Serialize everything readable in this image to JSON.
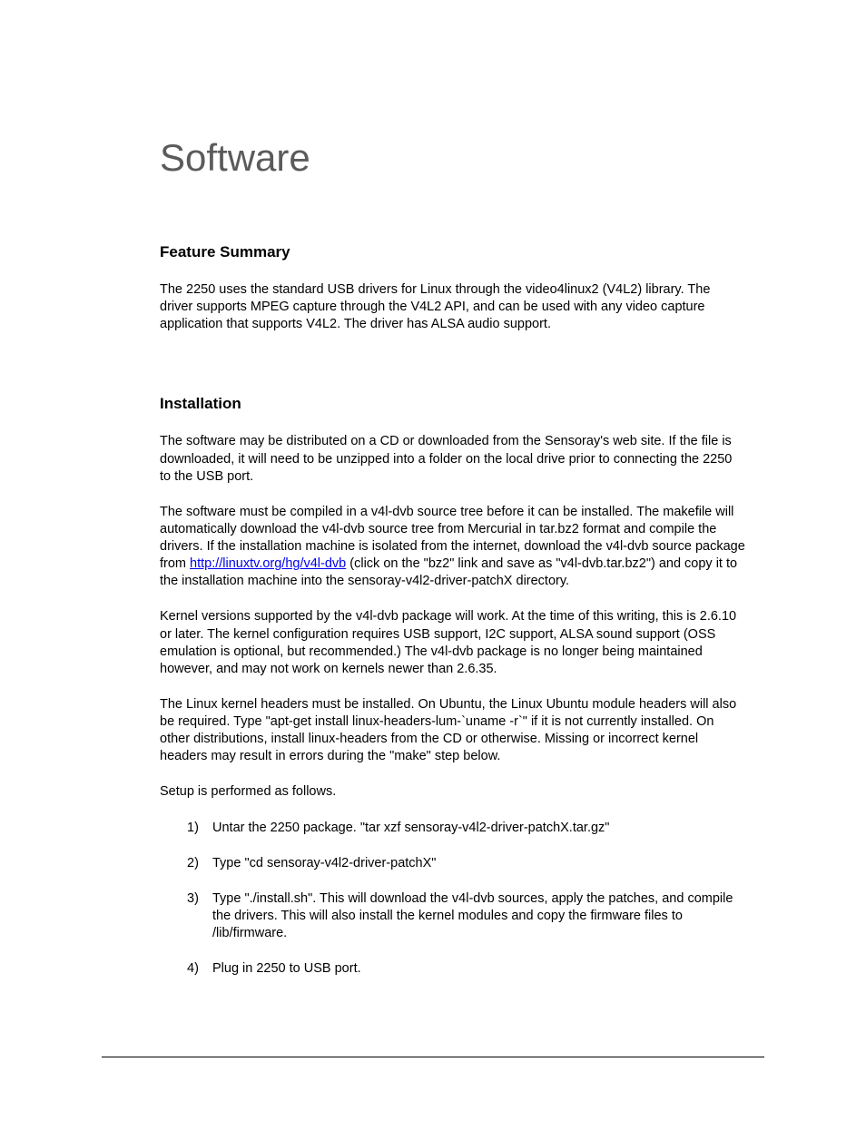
{
  "title": "Software",
  "sections": {
    "feature": {
      "heading": "Feature Summary",
      "p1": "The 2250 uses the standard USB drivers for Linux through the video4linux2 (V4L2) library.  The driver supports MPEG capture through the V4L2 API, and can be used with any video capture application that supports V4L2.  The driver has ALSA audio support."
    },
    "install": {
      "heading": "Installation",
      "p1": "The software may be distributed on a CD or downloaded from the Sensoray's web site.  If the file is downloaded, it will need to be unzipped into a folder on the local drive prior to connecting the 2250 to the USB port.",
      "p2a": "The software must be compiled in a v4l-dvb source tree before it can be installed. The makefile will automatically download the v4l-dvb source tree from Mercurial in tar.bz2 format and compile the drivers.  If the installation machine is isolated from the internet, download the v4l-dvb source package from ",
      "p2link": "http://linuxtv.org/hg/v4l-dvb",
      "p2b": " (click on the \"bz2\" link and save as \"v4l-dvb.tar.bz2\") and copy it to the installation machine into the sensoray-v4l2-driver-patchX directory.",
      "p3": "Kernel versions supported by the v4l-dvb package will work.  At the time of this writing, this is 2.6.10 or later.  The kernel configuration requires USB support, I2C support, ALSA sound support (OSS emulation is optional, but recommended.) The v4l-dvb package is no longer being maintained however, and may not work on kernels newer than 2.6.35.",
      "p4": "The Linux kernel headers must be installed.  On Ubuntu, the Linux Ubuntu module headers will also be required.  Type \"apt-get install linux-headers-lum-`uname -r`\" if it is not currently installed.  On other distributions, install linux-headers from the CD or otherwise.  Missing or incorrect kernel headers may result in errors during the \"make\" step below.",
      "p5": " Setup is performed as follows.",
      "steps": [
        "Untar the 2250 package.  \"tar xzf sensoray-v4l2-driver-patchX.tar.gz\"",
        "Type \"cd sensoray-v4l2-driver-patchX\"",
        "Type \"./install.sh\".  This will download the v4l-dvb sources, apply the patches, and compile the drivers.  This will also install the kernel modules and copy the firmware files to /lib/firmware.",
        "Plug in 2250 to USB port."
      ]
    }
  }
}
